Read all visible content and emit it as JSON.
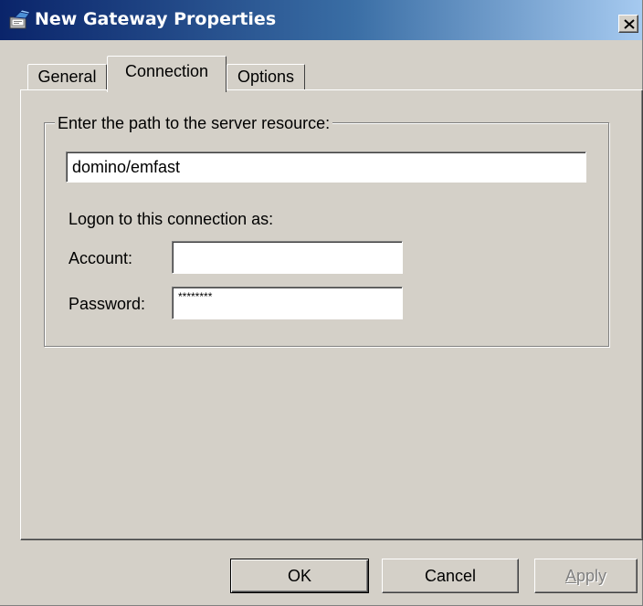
{
  "window": {
    "title": "New Gateway Properties",
    "icons": {
      "app": "gateway-properties-icon",
      "close": "close-icon"
    }
  },
  "tabs": [
    {
      "label": "General",
      "selected": false
    },
    {
      "label": "Connection",
      "selected": true
    },
    {
      "label": "Options",
      "selected": false
    }
  ],
  "connection": {
    "group_label": "Enter the path to the server resource:",
    "path_value": "domino/emfast",
    "logon_label": "Logon to this connection as:",
    "account_label": "Account:",
    "account_value": "",
    "password_label": "Password:",
    "password_value": "********"
  },
  "buttons": {
    "ok": "OK",
    "cancel": "Cancel",
    "apply_first": "A",
    "apply_rest": "pply"
  },
  "colors": {
    "face": "#d4d0c8",
    "titlebar_start": "#0a246a",
    "titlebar_end": "#a6caf0",
    "disabled_text": "#808080"
  }
}
